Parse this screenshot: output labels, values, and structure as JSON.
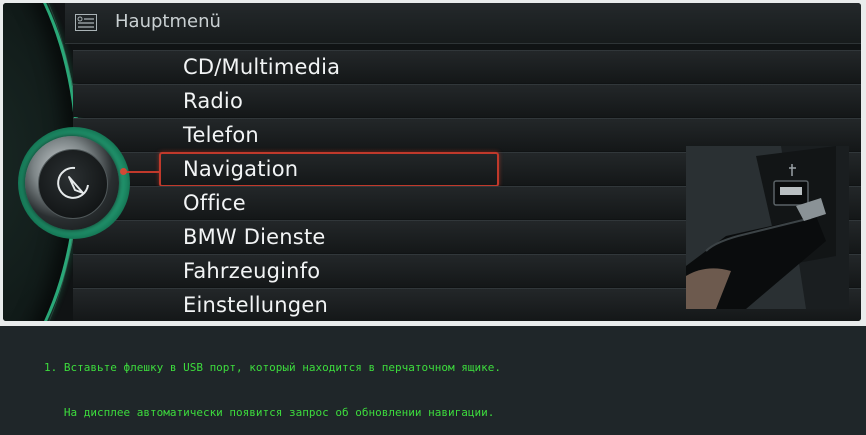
{
  "header": {
    "title": "Hauptmenü",
    "icon": "menu-list-icon"
  },
  "menu": {
    "items": [
      {
        "label": "CD/Multimedia"
      },
      {
        "label": "Radio"
      },
      {
        "label": "Telefon"
      },
      {
        "label": "Navigation"
      },
      {
        "label": "Office"
      },
      {
        "label": "BMW Dienste"
      },
      {
        "label": "Fahrzeuginfo"
      },
      {
        "label": "Einstellungen"
      }
    ],
    "selected": "Navigation"
  },
  "controller": {
    "icon": "navigation-compass-icon"
  },
  "photo": {
    "icon": "usb-port-icon"
  },
  "instructions": {
    "line1": "1. Вставьте флешку в USB порт, который находится в перчаточном ящике.",
    "line2": "   На дисплее автоматически появится запрос об обновлении навигации."
  },
  "colors": {
    "accent_green": "#2aa878",
    "selection_red": "#c0392b",
    "text_green": "#3ddc3d"
  }
}
